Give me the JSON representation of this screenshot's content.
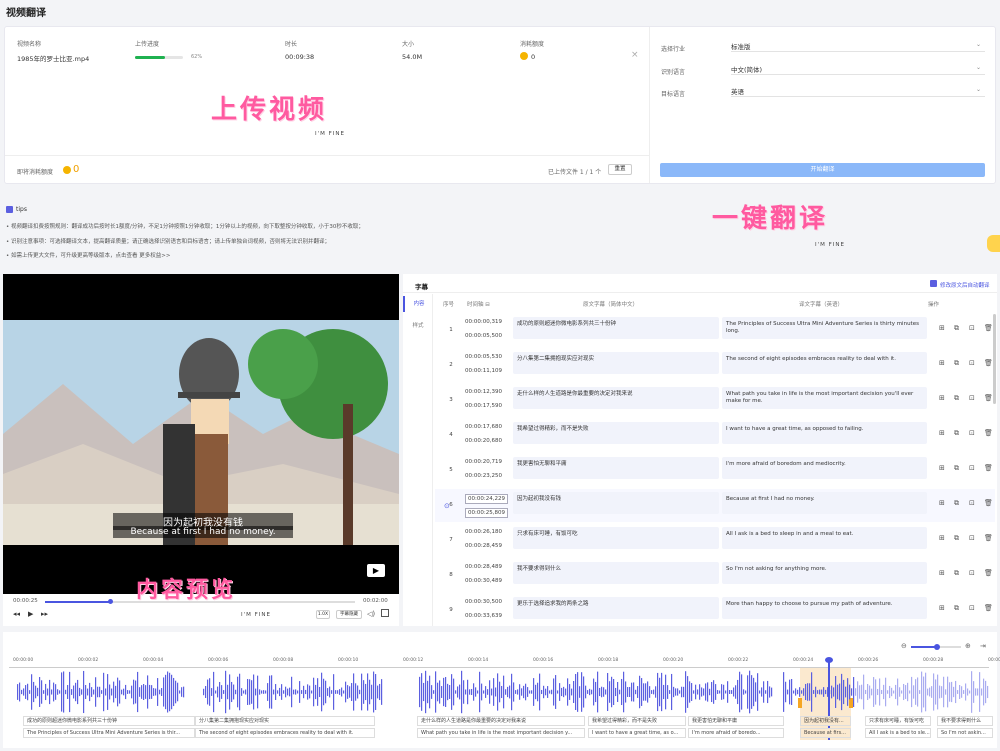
{
  "page": {
    "title": "视频翻译"
  },
  "upload": {
    "headers": {
      "name": "视频名称",
      "progress": "上传进度",
      "duration": "时长",
      "size": "大小",
      "cost": "消耗额度"
    },
    "file": {
      "name": "1985年的罗士比亚.mp4",
      "progress_label": "62%",
      "progress_value": 0.62,
      "duration": "00:09:38",
      "size": "54.0M",
      "cost": "0"
    },
    "deco": {
      "title": "上传视频",
      "sub": "I'M FINE"
    },
    "balance_label": "即将消耗额度",
    "balance_value": "0",
    "uploaded_count": "已上传文件 1 / 1 个",
    "clear_label": "重置"
  },
  "settings": {
    "industry_label": "选择行业",
    "industry_value": "标准版",
    "recognize_label": "识别语言",
    "recognize_value": "中文(简体)",
    "target_label": "目标语言",
    "target_value": "英语",
    "start_label": "开始翻译"
  },
  "tips": {
    "title": "tips",
    "lines": [
      "• 视频翻译扣费按照规则：翻译成功后按时长1额度/分钟，不足1分钟按照1分钟收取；1分钟以上的视频，向下取整按分钟收取，小于30秒不收取；",
      "• 识别注意事项：可选择翻译文本，提高翻译质量；请正确选择识别语言和目标语言；请上传单独台词视频，否则将无法识别并翻译；",
      "• 如需上传更大文件，可升级更高等级版本，点击查看 更多权益>>"
    ],
    "deco_title": "一键翻译",
    "deco_sub": "I'M FINE"
  },
  "video": {
    "sub_cn": "因为起初我没有钱",
    "sub_en": "Because at first I had no money.",
    "current": "00:00:25",
    "total": "00:02:00",
    "played_fraction": 0.21,
    "speed": "1.0X",
    "subtitle_toggle": "字幕隐藏",
    "deco_title": "内容预览",
    "deco_sub": "I'M FINE"
  },
  "subtitles": {
    "title": "字幕",
    "tabs": [
      "内容",
      "样式"
    ],
    "sync_label": "修改原文后自动翻译",
    "headers": {
      "index": "序号",
      "time": "时间轴 ⊟",
      "source": "原文字幕（简体中文）",
      "target": "译文字幕（英语）",
      "ops": "操作"
    },
    "rows": [
      {
        "index": "1",
        "start": "00:00:00,319",
        "end": "00:00:05,500",
        "source": "成功的原则超迷你微电影系列共三十份钟",
        "target": "The Principles of Success Ultra Mini Adventure Series is thirty minutes long."
      },
      {
        "index": "2",
        "start": "00:00:05,530",
        "end": "00:00:11,109",
        "source": "分八集第二集拥抱现实应对现实",
        "target": "The second of eight episodes embraces reality to deal with it."
      },
      {
        "index": "3",
        "start": "00:00:12,390",
        "end": "00:00:17,590",
        "source": "走什么样的人生道路是你最重要的决定对我来说",
        "target": "What path you take in life is the most important decision you'll ever make for me."
      },
      {
        "index": "4",
        "start": "00:00:17,680",
        "end": "00:00:20,680",
        "source": "我希望过得精彩，而不是失败",
        "target": "I want to have a great time, as opposed to failing."
      },
      {
        "index": "5",
        "start": "00:00:20,719",
        "end": "00:00:23,250",
        "source": "我更害怕无聊和平庸",
        "target": "I'm more afraid of boredom and mediocrity."
      },
      {
        "index": "6",
        "start": "00:00:24,229",
        "end": "00:00:25,809",
        "source": "因为起初我没有钱",
        "target": "Because at first I had no money."
      },
      {
        "index": "7",
        "start": "00:00:26,180",
        "end": "00:00:28,459",
        "source": "只求有床可睡，有饭可吃",
        "target": "All I ask is a bed to sleep in and a meal to eat."
      },
      {
        "index": "8",
        "start": "00:00:28,489",
        "end": "00:00:30,489",
        "source": "我不要求得到什么",
        "target": "So I'm not asking for anything more."
      },
      {
        "index": "9",
        "start": "00:00:30,500",
        "end": "00:00:33,639",
        "source": "更乐于选择追求我的两条之路",
        "target": "More than happy to choose to pursue my path of adventure."
      }
    ]
  },
  "waveform": {
    "ticks": [
      "00:00:00",
      "00:00:02",
      "00:00:04",
      "00:00:06",
      "00:00:08",
      "00:00:10",
      "00:00:12",
      "00:00:14",
      "00:00:16",
      "00:00:18",
      "00:00:20",
      "00:00:22",
      "00:00:24",
      "00:00:26",
      "00:00:28",
      "00:00:30"
    ],
    "segments": [
      {
        "cn": "成功的原则超迷你微电影系列共三十份钟",
        "en": "The Principles of Success Ultra Mini Adventure Series is thir..."
      },
      {
        "cn": "分八集第二集拥抱现实应对现实",
        "en": "The second of eight episodes embraces reality to deal with it."
      },
      {
        "cn": "走什么样的人生道路是你最重要的决定对我来说",
        "en": "What path you take in life is the most important decision y..."
      },
      {
        "cn": "我希望过得精彩，而不是失败",
        "en": "I want to have a great time, as o..."
      },
      {
        "cn": "我更害怕无聊和平庸",
        "en": "I'm more afraid of boredo..."
      },
      {
        "cn": "因为起初我没有...",
        "en": "Because at firs..."
      },
      {
        "cn": "只求有床可睡，有饭可吃",
        "en": "All I ask is a bed to sle..."
      },
      {
        "cn": "我不要求得到什么",
        "en": "So I'm not askin..."
      }
    ]
  },
  "colors": {
    "accent": "#4a55e0",
    "wave": "#5b5fe0",
    "progress": "#1fb150",
    "button": "#8bb8f9",
    "highlight": "#fbe9cf",
    "deco": "#ff5aa0"
  }
}
